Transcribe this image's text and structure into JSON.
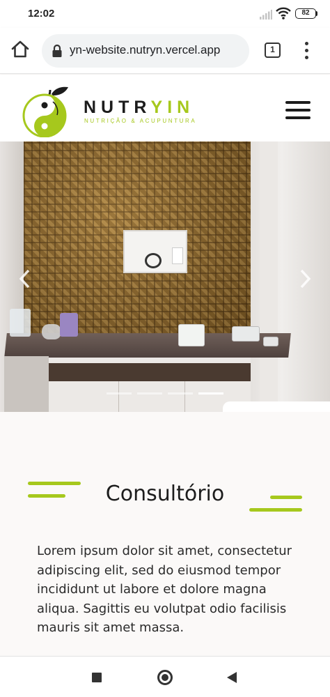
{
  "status_bar": {
    "time": "12:02",
    "battery_level": "82",
    "icons": [
      "signal-icon",
      "wifi-icon",
      "battery-icon"
    ]
  },
  "browser": {
    "url": "yn-website.nutryn.vercel.app",
    "tab_count": "1",
    "icons": [
      "home-icon",
      "lock-icon",
      "tabs-icon",
      "more-vert-icon"
    ]
  },
  "site_header": {
    "brand_dark": "NUTR",
    "brand_green": "YIN",
    "brand_sub": "NUTRIÇÃO & ACUPUNTURA",
    "icons": [
      "yin-yang-apple-logo",
      "hamburger-menu-icon"
    ]
  },
  "carousel": {
    "slide_count": 4,
    "active_index": 3,
    "icons": [
      "chevron-left-icon",
      "chevron-right-icon"
    ]
  },
  "section": {
    "title": "Consultório",
    "body": "Lorem ipsum dolor sit amet, consectetur adipiscing elit, sed do eiusmod tempor incididunt ut labore et dolore magna aliqua. Sagittis eu volutpat odio facilisis mauris sit amet massa."
  },
  "colors": {
    "brand_green": "#a6c81d",
    "text_dark": "#1d1d1d",
    "background": "#fbf9f8"
  }
}
